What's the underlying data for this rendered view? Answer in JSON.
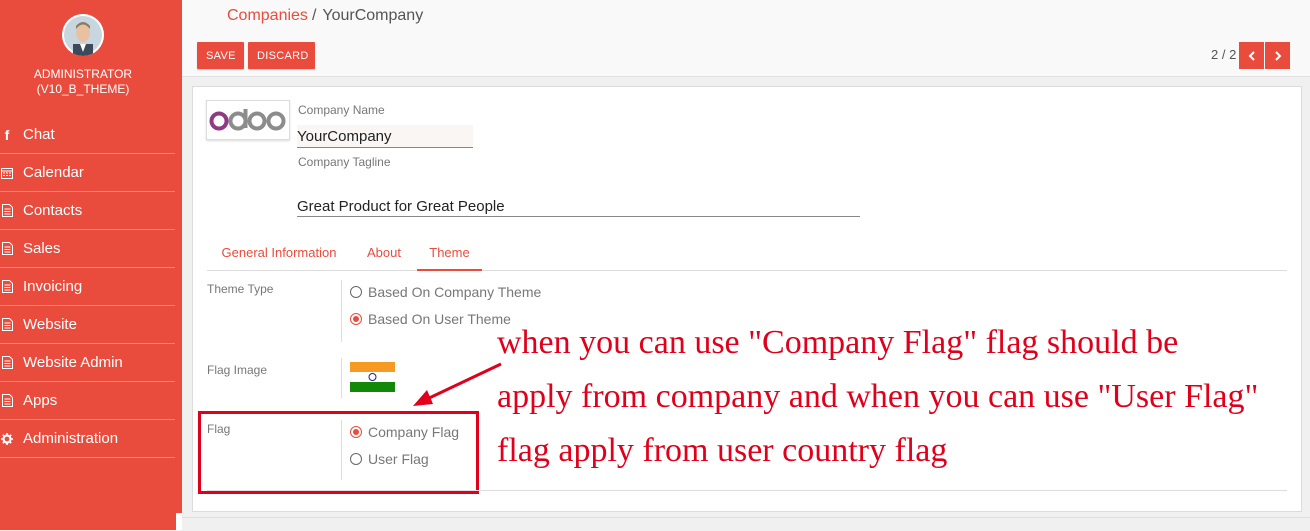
{
  "sidebar": {
    "user_name": "ADMINISTRATOR",
    "user_sub": "(V10_B_THEME)",
    "items": [
      {
        "label": "Chat",
        "icon": "facebook-icon"
      },
      {
        "label": "Calendar",
        "icon": "calendar-icon"
      },
      {
        "label": "Contacts",
        "icon": "document-icon"
      },
      {
        "label": "Sales",
        "icon": "document-icon"
      },
      {
        "label": "Invoicing",
        "icon": "document-icon"
      },
      {
        "label": "Website",
        "icon": "document-icon"
      },
      {
        "label": "Website Admin",
        "icon": "document-icon"
      },
      {
        "label": "Apps",
        "icon": "document-icon"
      },
      {
        "label": "Administration",
        "icon": "gear-icon"
      }
    ]
  },
  "breadcrumb": {
    "parent": "Companies",
    "separator": "/",
    "current": "YourCompany"
  },
  "toolbar": {
    "save_label": "SAVE",
    "discard_label": "DISCARD"
  },
  "pager": {
    "value": "2 / 2"
  },
  "form": {
    "logo_text": "odoo",
    "company_name_label": "Company Name",
    "company_name_value": "YourCompany",
    "tagline_label": "Company Tagline",
    "tagline_value": "Great Product for Great People",
    "tabs": [
      "General Information",
      "About",
      "Theme"
    ],
    "active_tab": "Theme",
    "theme_type_label": "Theme Type",
    "theme_options": [
      "Based On Company Theme",
      "Based On User Theme"
    ],
    "theme_selected": "Based On User Theme",
    "flag_image_label": "Flag Image",
    "flag_label": "Flag",
    "flag_options": [
      "Company Flag",
      "User Flag"
    ],
    "flag_selected": "Company Flag"
  },
  "annotation": {
    "lines": [
      "when you can use \"Company Flag\" flag should be",
      "apply from company and when you can use \"User Flag\"",
      "flag apply from user country flag"
    ]
  },
  "colors": {
    "accent": "#e94c3d",
    "annotation": "#e0001b"
  }
}
